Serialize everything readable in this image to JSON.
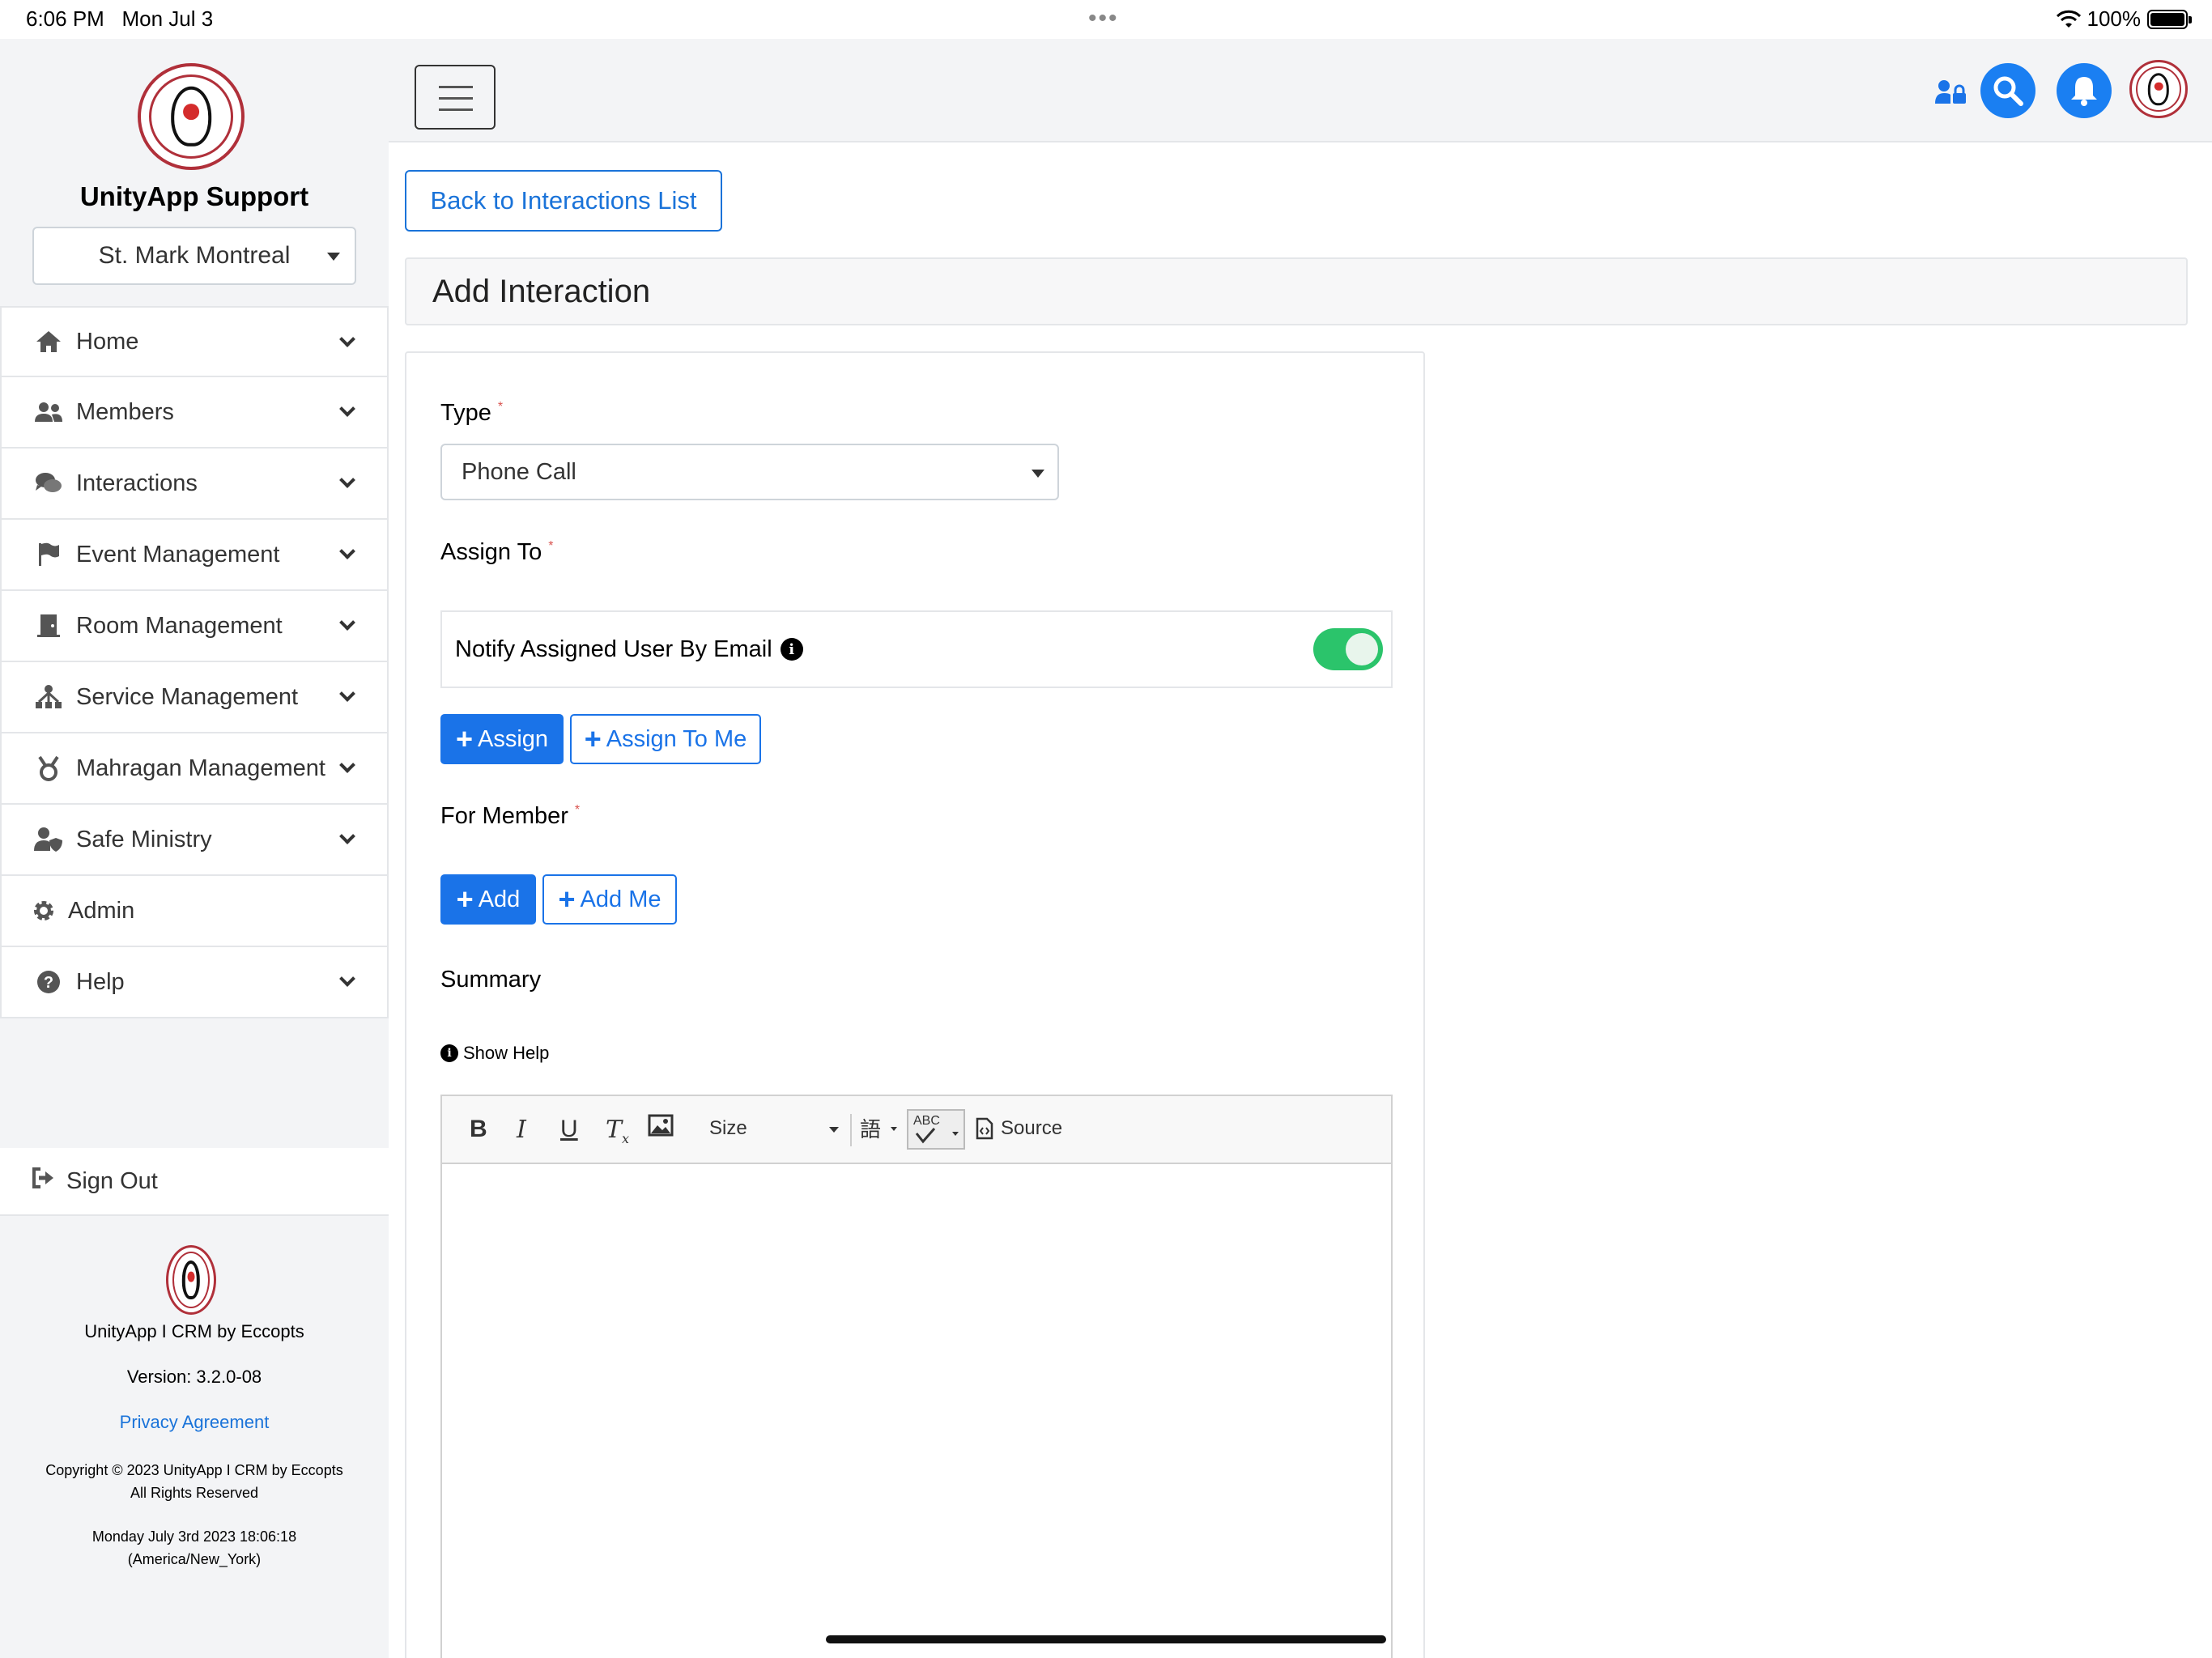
{
  "status": {
    "time": "6:06 PM",
    "date": "Mon Jul 3",
    "battery": "100%"
  },
  "sidebar": {
    "brand_title": "UnityApp Support",
    "church_selected": "St. Mark Montreal",
    "nav": [
      {
        "label": "Home",
        "icon": "home-icon"
      },
      {
        "label": "Members",
        "icon": "users-icon"
      },
      {
        "label": "Interactions",
        "icon": "comments-icon"
      },
      {
        "label": "Event Management",
        "icon": "flag-icon"
      },
      {
        "label": "Room Management",
        "icon": "door-icon"
      },
      {
        "label": "Service Management",
        "icon": "sitemap-icon"
      },
      {
        "label": "Mahragan Management",
        "icon": "medal-icon"
      },
      {
        "label": "Safe Ministry",
        "icon": "user-shield-icon"
      },
      {
        "label": "Admin",
        "icon": "gear-icon"
      },
      {
        "label": "Help",
        "icon": "question-circle-icon"
      }
    ],
    "sign_out": "Sign Out",
    "footer": {
      "app_name": "UnityApp I CRM by Eccopts",
      "version": "Version: 3.2.0-08",
      "privacy": "Privacy Agreement",
      "copyright_1": "Copyright © 2023 UnityApp I CRM by Eccopts",
      "copyright_2": "All Rights Reserved",
      "timestamp_1": "Monday July 3rd 2023 18:06:18",
      "timestamp_2": "(America/New_York)"
    }
  },
  "main": {
    "back_button": "Back to Interactions List",
    "page_title": "Add Interaction",
    "form": {
      "type_label": "Type",
      "type_value": "Phone Call",
      "assign_label": "Assign To",
      "notify_label": "Notify Assigned User By Email",
      "notify_enabled": true,
      "assign_button": "Assign",
      "assign_me_button": "Assign To Me",
      "member_label": "For Member",
      "add_button": "Add",
      "add_me_button": "Add Me",
      "summary_label": "Summary",
      "show_help": "Show Help",
      "editor": {
        "size_label": "Size",
        "source_label": "Source",
        "spell_label": "ABC"
      }
    }
  },
  "colors": {
    "primary": "#1a73e8",
    "toggle_on": "#2bc46b",
    "required": "#d9534f"
  }
}
